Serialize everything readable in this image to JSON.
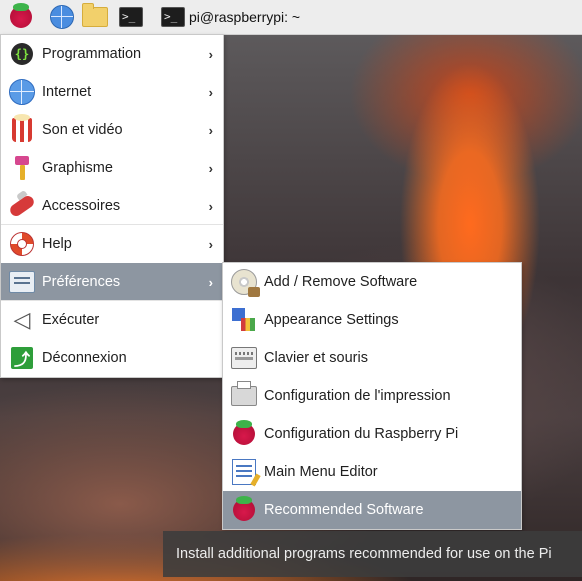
{
  "taskbar": {
    "menu_icon": "raspberry-pi-icon",
    "launchers": [
      "web-browser-icon",
      "file-manager-icon",
      "terminal-icon"
    ],
    "window_title": "pi@raspberrypi: ~"
  },
  "main_menu": {
    "items": [
      {
        "label": "Programmation",
        "icon": "programming-icon",
        "has_submenu": true
      },
      {
        "label": "Internet",
        "icon": "globe-icon",
        "has_submenu": true
      },
      {
        "label": "Son et vidéo",
        "icon": "popcorn-icon",
        "has_submenu": true
      },
      {
        "label": "Graphisme",
        "icon": "paintbrush-icon",
        "has_submenu": true
      },
      {
        "label": "Accessoires",
        "icon": "pocket-knife-icon",
        "has_submenu": true
      },
      {
        "label": "Help",
        "icon": "lifebuoy-icon",
        "has_submenu": true
      },
      {
        "label": "Préférences",
        "icon": "preferences-icon",
        "has_submenu": true,
        "selected": true
      },
      {
        "label": "Exécuter",
        "icon": "paper-plane-icon",
        "has_submenu": false
      },
      {
        "label": "Déconnexion",
        "icon": "exit-icon",
        "has_submenu": false
      }
    ],
    "arrow": "›"
  },
  "preferences_submenu": {
    "items": [
      {
        "label": "Add / Remove Software",
        "icon": "software-cd-icon"
      },
      {
        "label": "Appearance Settings",
        "icon": "appearance-icon"
      },
      {
        "label": "Clavier et souris",
        "icon": "keyboard-mouse-icon"
      },
      {
        "label": "Configuration de l'impression",
        "icon": "printer-icon"
      },
      {
        "label": "Configuration du Raspberry Pi",
        "icon": "raspberry-pi-icon"
      },
      {
        "label": "Main Menu Editor",
        "icon": "menu-editor-icon"
      },
      {
        "label": "Recommended Software",
        "icon": "raspberry-pi-icon",
        "selected": true
      }
    ]
  },
  "tooltip": {
    "text": "Install additional programs recommended for use on the Pi"
  },
  "colors": {
    "taskbar_bg": "#ededed",
    "menu_bg": "#ffffff",
    "selection_bg": "#8d96a1",
    "tooltip_bg": "#3c3c3c"
  }
}
